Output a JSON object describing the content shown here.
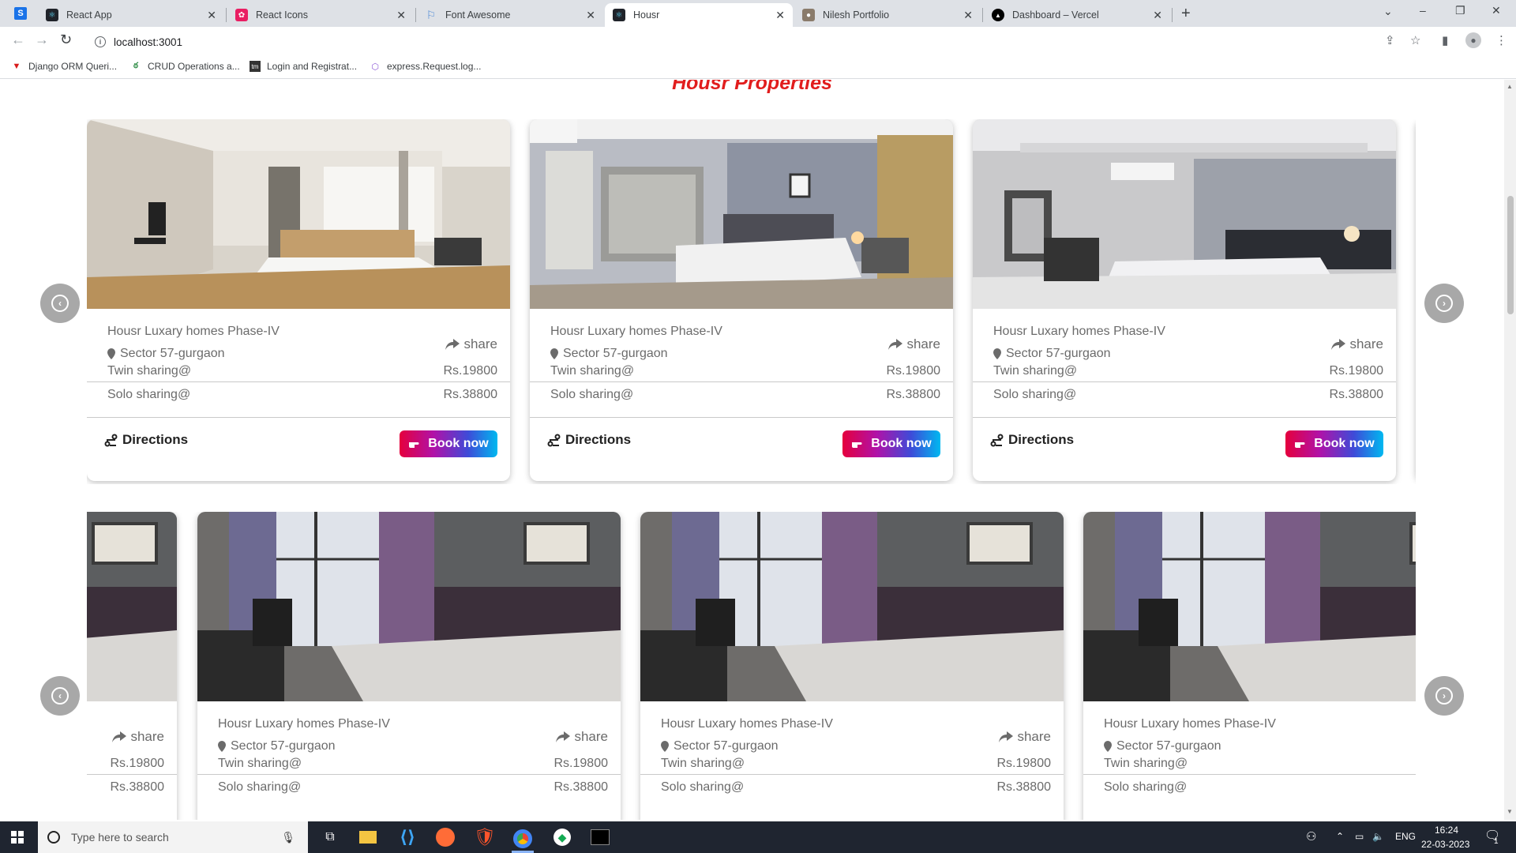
{
  "browser": {
    "tabs": [
      {
        "label": "React App",
        "icon": "react-icon",
        "active": false
      },
      {
        "label": "React Icons",
        "icon": "react-icons-icon",
        "active": false
      },
      {
        "label": "Font Awesome",
        "icon": "flag-icon",
        "active": false
      },
      {
        "label": "Housr",
        "icon": "react-icon",
        "active": true
      },
      {
        "label": "Nilesh Portfolio",
        "icon": "person-icon",
        "active": false
      },
      {
        "label": "Dashboard – Vercel",
        "icon": "vercel-icon",
        "active": false
      }
    ],
    "url": "localhost:3001",
    "bookmarks": [
      {
        "label": "Django ORM Queri..."
      },
      {
        "label": "CRUD Operations a..."
      },
      {
        "label": "Login and Registrat..."
      },
      {
        "label": "express.Request.log..."
      }
    ]
  },
  "page": {
    "title": "Housr Properties",
    "card_labels": {
      "name": "Housr Luxary homes Phase-IV",
      "location": "Sector 57-gurgaon",
      "share": "share",
      "twin": "Twin sharing@",
      "solo": "Solo sharing@",
      "twin_price": "Rs.19800",
      "solo_price": "Rs.38800",
      "directions": "Directions",
      "book": "Book now"
    },
    "row1_cards": [
      {
        "name": "Housr Luxary homes Phase-IV",
        "location": "Sector 57-gurgaon",
        "share": "share",
        "twin": "Twin sharing@",
        "twin_price": "Rs.19800",
        "solo": "Solo sharing@",
        "solo_price": "Rs.38800",
        "directions": "Directions",
        "book": "Book now"
      },
      {
        "name": "Housr Luxary homes Phase-IV",
        "location": "Sector 57-gurgaon",
        "share": "share",
        "twin": "Twin sharing@",
        "twin_price": "Rs.19800",
        "solo": "Solo sharing@",
        "solo_price": "Rs.38800",
        "directions": "Directions",
        "book": "Book now"
      },
      {
        "name": "Housr Luxary homes Phase-IV",
        "location": "Sector 57-gurgaon",
        "share": "share",
        "twin": "Twin sharing@",
        "twin_price": "Rs.19800",
        "solo": "Solo sharing@",
        "solo_price": "Rs.38800",
        "directions": "Directions",
        "book": "Book now"
      }
    ],
    "row2_cards": [
      {
        "share": "share",
        "twin_price": "Rs.19800",
        "solo_price": "Rs.38800"
      },
      {
        "name": "Housr Luxary homes Phase-IV",
        "location": "Sector 57-gurgaon",
        "share": "share",
        "twin": "Twin sharing@",
        "twin_price": "Rs.19800",
        "solo": "Solo sharing@",
        "solo_price": "Rs.38800"
      },
      {
        "name": "Housr Luxary homes Phase-IV",
        "location": "Sector 57-gurgaon",
        "share": "share",
        "twin": "Twin sharing@",
        "twin_price": "Rs.19800",
        "solo": "Solo sharing@",
        "solo_price": "Rs.38800"
      },
      {
        "name": "Housr Luxary homes Phase-IV",
        "location": "Sector 57-gurgaon",
        "twin": "Twin sharing@",
        "solo": "Solo sharing@"
      }
    ]
  },
  "taskbar": {
    "search_placeholder": "Type here to search",
    "language": "ENG",
    "time": "16:24",
    "date": "22-03-2023",
    "notification_count": "1"
  },
  "colors": {
    "title": "#e11d1d",
    "book_gradient": [
      "#e5003d",
      "#b012a8",
      "#3e4bd8",
      "#00b8f0"
    ],
    "arrow_button": "#a8a8a8",
    "taskbar": "#1f2530"
  }
}
